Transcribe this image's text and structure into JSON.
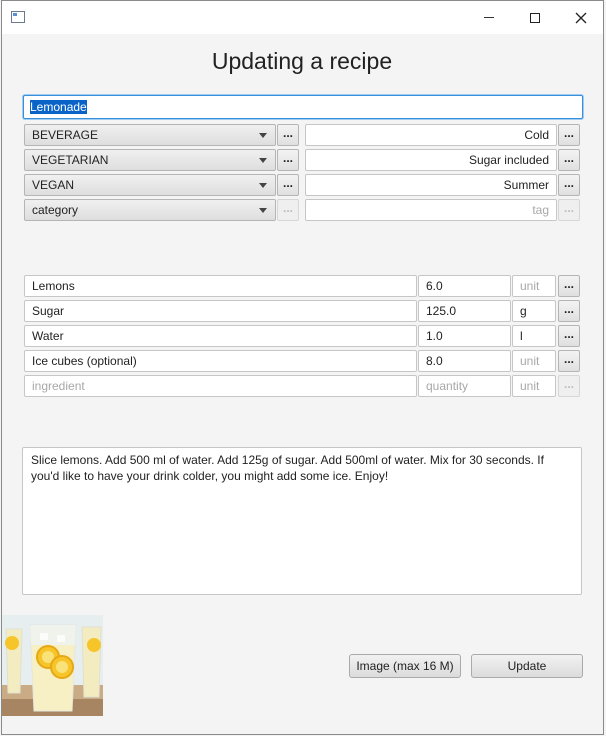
{
  "window": {
    "title": ""
  },
  "form": {
    "title": "Updating a recipe",
    "name_value": "Lemonade",
    "more_label": "...",
    "categories": [
      {
        "value": "BEVERAGE",
        "placeholder": false
      },
      {
        "value": "VEGETARIAN",
        "placeholder": false
      },
      {
        "value": "VEGAN",
        "placeholder": false
      },
      {
        "value": "category",
        "placeholder": true
      }
    ],
    "tags": [
      {
        "value": "Cold",
        "placeholder": false
      },
      {
        "value": "Sugar included",
        "placeholder": false
      },
      {
        "value": "Summer",
        "placeholder": false
      },
      {
        "value": "tag",
        "placeholder": true
      }
    ],
    "ingredients": [
      {
        "name": "Lemons",
        "quantity": "6.0",
        "unit": "unit",
        "unit_placeholder": true
      },
      {
        "name": "Sugar",
        "quantity": "125.0",
        "unit": "g",
        "unit_placeholder": false
      },
      {
        "name": "Water",
        "quantity": "1.0",
        "unit": "l",
        "unit_placeholder": false
      },
      {
        "name": "Ice cubes (optional)",
        "quantity": "8.0",
        "unit": "unit",
        "unit_placeholder": true
      },
      {
        "name": "ingredient",
        "quantity": "quantity",
        "unit": "unit",
        "placeholder": true
      }
    ],
    "instructions": "Slice lemons. Add 500 ml of water. Add 125g of sugar. Add 500ml of water. Mix for 30 seconds. If you'd like to have your drink colder, you might add some ice. Enjoy!",
    "image_button": "Image (max 16 M)",
    "update_button": "Update"
  },
  "icons": {
    "app": "window-icon",
    "minimize": "minimize-icon",
    "maximize": "maximize-icon",
    "close": "close-icon",
    "photo": "lemonade-glasses-image"
  }
}
